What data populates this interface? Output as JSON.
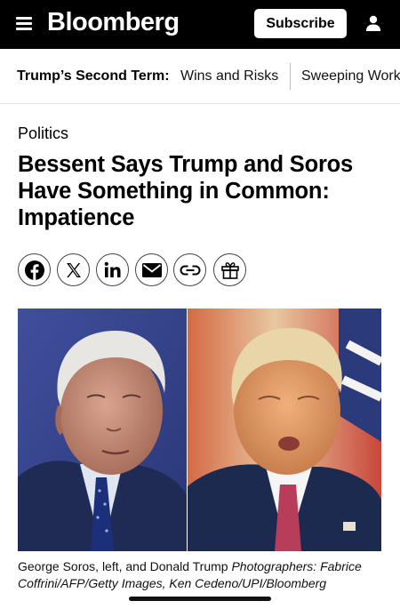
{
  "header": {
    "logo": "Bloomberg",
    "subscribe_label": "Subscribe",
    "menu_icon": "hamburger-menu-icon",
    "account_icon": "user-icon"
  },
  "topic_bar": {
    "title": "Trump’s Second Term:",
    "links": [
      "Wins and Risks",
      "Sweeping Work"
    ]
  },
  "article": {
    "section": "Politics",
    "headline": "Bessent Says Trump and Soros Have Something in Common: Impatience",
    "share_icons": [
      "facebook-icon",
      "x-icon",
      "linkedin-icon",
      "email-icon",
      "link-icon",
      "gift-icon"
    ],
    "caption": "George Soros, left, and Donald Trump",
    "caption_credit": "Photographers: Fabrice Coffrini/AFP/Getty Images, Ken Cedeno/UPI/Bloomberg"
  },
  "colors": {
    "header_bg": "#000000",
    "text": "#000000",
    "divider": "#e4e4e4"
  }
}
